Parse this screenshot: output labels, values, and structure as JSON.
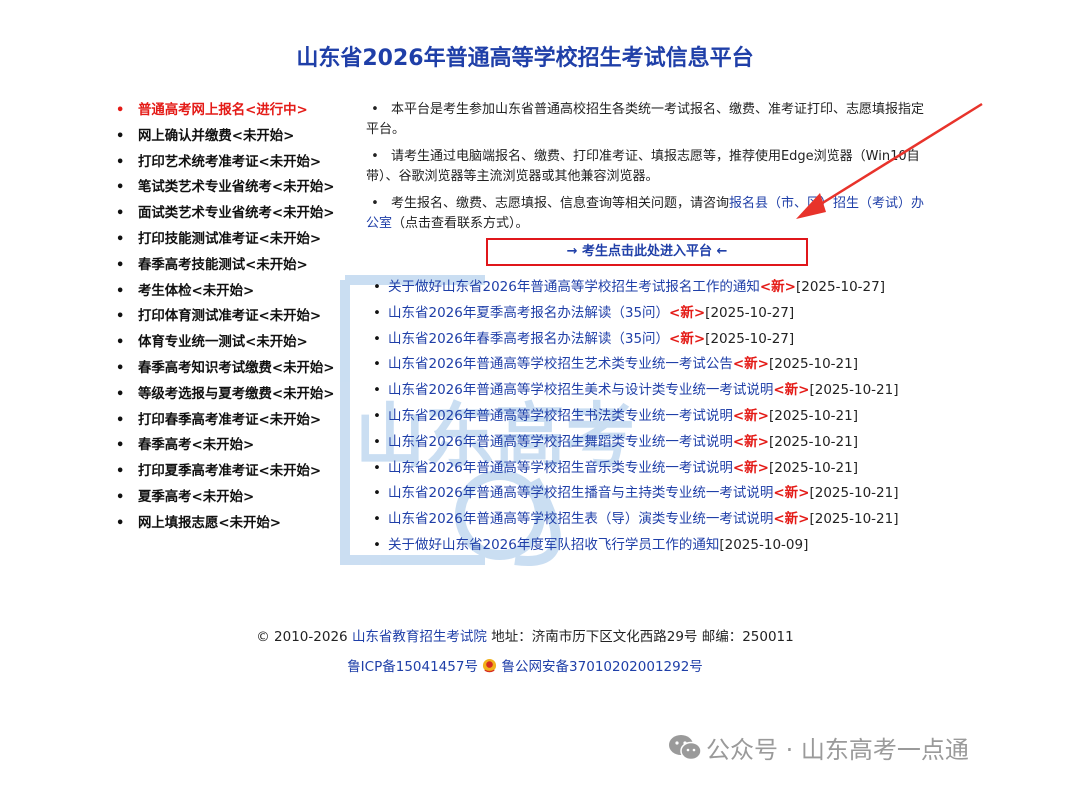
{
  "page": {
    "title": "山东省2026年普通高等学校招生考试信息平台"
  },
  "leftnav": [
    {
      "label": "普通高考网上报名<进行中>",
      "active": true
    },
    {
      "label": "网上确认并缴费<未开始>"
    },
    {
      "label": "打印艺术统考准考证<未开始>"
    },
    {
      "label": "笔试类艺术专业省统考<未开始>"
    },
    {
      "label": "面试类艺术专业省统考<未开始>"
    },
    {
      "label": "打印技能测试准考证<未开始>"
    },
    {
      "label": "春季高考技能测试<未开始>"
    },
    {
      "label": "考生体检<未开始>"
    },
    {
      "label": "打印体育测试准考证<未开始>"
    },
    {
      "label": "体育专业统一测试<未开始>"
    },
    {
      "label": "春季高考知识考试缴费<未开始>"
    },
    {
      "label": "等级考选报与夏考缴费<未开始>"
    },
    {
      "label": "打印春季高考准考证<未开始>"
    },
    {
      "label": "春季高考<未开始>"
    },
    {
      "label": "打印夏季高考准考证<未开始>"
    },
    {
      "label": "夏季高考<未开始>"
    },
    {
      "label": "网上填报志愿<未开始>"
    }
  ],
  "notices": {
    "n1": "本平台是考生参加山东省普通高校招生各类统一考试报名、缴费、准考证打印、志愿填报指定平台。",
    "n2": "请考生通过电脑端报名、缴费、打印准考证、填报志愿等，推荐使用Edge浏览器（Win10自带）、谷歌浏览器等主流浏览器或其他兼容浏览器。",
    "n3_prefix": "考生报名、缴费、志愿填报、信息查询等相关问题，请咨询",
    "n3_link": "报名县（市、区）招生（考试）办公室",
    "n3_suffix": "（点击查看联系方式）。"
  },
  "enter_button": "→ 考生点击此处进入平台 ←",
  "news": [
    {
      "title": "关于做好山东省2026年普通高等学校招生考试报名工作的通知",
      "new": "<新>",
      "date": "[2025-10-27]"
    },
    {
      "title": "山东省2026年夏季高考报名办法解读（35问）",
      "new": "<新>",
      "date": "[2025-10-27]"
    },
    {
      "title": "山东省2026年春季高考报名办法解读（35问）",
      "new": "<新>",
      "date": "[2025-10-27]"
    },
    {
      "title": "山东省2026年普通高等学校招生艺术类专业统一考试公告",
      "new": "<新>",
      "date": "[2025-10-21]"
    },
    {
      "title": "山东省2026年普通高等学校招生美术与设计类专业统一考试说明",
      "new": "<新>",
      "date": "[2025-10-21]"
    },
    {
      "title": "山东省2026年普通高等学校招生书法类专业统一考试说明",
      "new": "<新>",
      "date": "[2025-10-21]"
    },
    {
      "title": "山东省2026年普通高等学校招生舞蹈类专业统一考试说明",
      "new": "<新>",
      "date": "[2025-10-21]"
    },
    {
      "title": "山东省2026年普通高等学校招生音乐类专业统一考试说明",
      "new": "<新>",
      "date": "[2025-10-21]"
    },
    {
      "title": "山东省2026年普通高等学校招生播音与主持类专业统一考试说明",
      "new": "<新>",
      "date": "[2025-10-21]"
    },
    {
      "title": "山东省2026年普通高等学校招生表（导）演类专业统一考试说明",
      "new": "<新>",
      "date": "[2025-10-21]"
    },
    {
      "title": "关于做好山东省2026年度军队招收飞行学员工作的通知",
      "new": "",
      "date": "[2025-10-09]"
    }
  ],
  "footer": {
    "copyright": "© 2010-2026",
    "org_link": "山东省教育招生考试院",
    "address": "地址：济南市历下区文化西路29号 邮编：250011",
    "icp": "鲁ICP备15041457号",
    "police": "鲁公网安备37010202001292号"
  },
  "watermark_text": "山东高考一点通",
  "wechat_label": "公众号 · 山东高考一点通",
  "colors": {
    "title": "#1f3fa8",
    "link": "#1f3fa8",
    "active": "#e41b17",
    "new_tag": "#e41b17",
    "button_border": "#e0161b",
    "arrow": "#e8332b"
  }
}
